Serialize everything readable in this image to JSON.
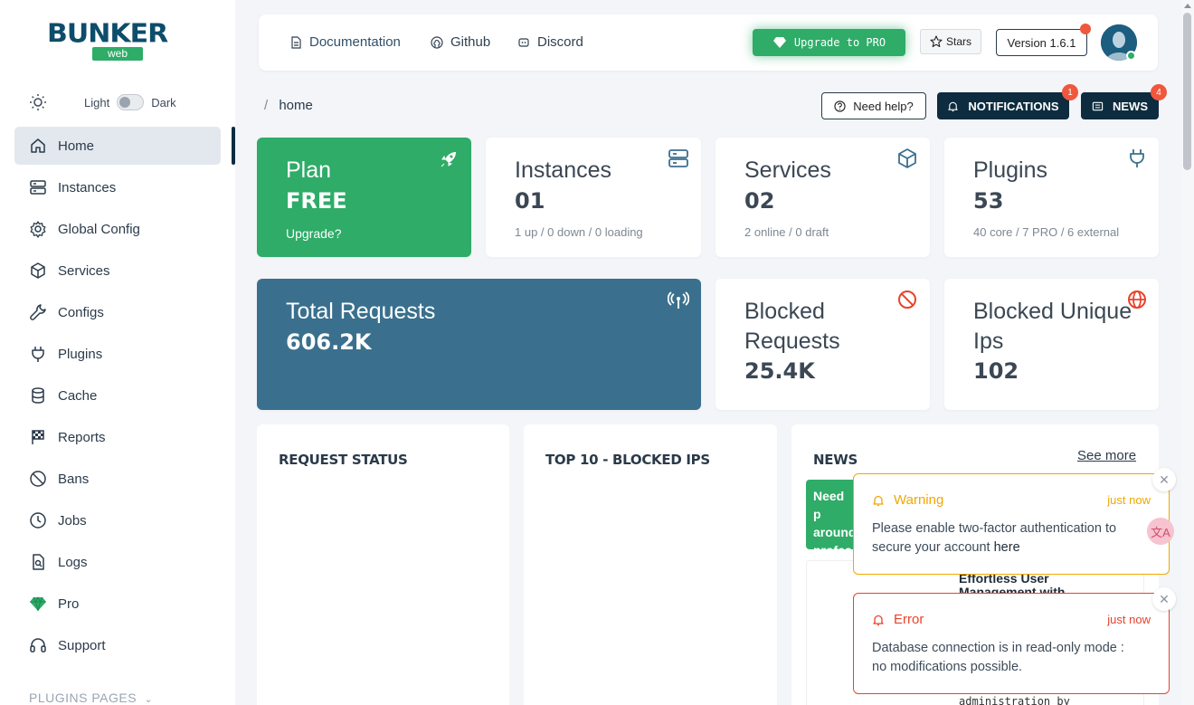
{
  "sidebar": {
    "logo_text": "BUNKER",
    "logo_sub": "web",
    "theme": {
      "light_label": "Light",
      "dark_label": "Dark"
    },
    "items": [
      {
        "label": "Home",
        "icon": "home-icon"
      },
      {
        "label": "Instances",
        "icon": "server-icon"
      },
      {
        "label": "Global Config",
        "icon": "gear-icon"
      },
      {
        "label": "Services",
        "icon": "cube-icon"
      },
      {
        "label": "Configs",
        "icon": "wrench-icon"
      },
      {
        "label": "Plugins",
        "icon": "plug-icon"
      },
      {
        "label": "Cache",
        "icon": "database-icon"
      },
      {
        "label": "Reports",
        "icon": "flag-icon"
      },
      {
        "label": "Bans",
        "icon": "ban-icon"
      },
      {
        "label": "Jobs",
        "icon": "clock-icon"
      },
      {
        "label": "Logs",
        "icon": "file-search-icon"
      },
      {
        "label": "Pro",
        "icon": "diamond-icon"
      },
      {
        "label": "Support",
        "icon": "headset-icon"
      }
    ],
    "plugins_pages_label": "PLUGINS PAGES"
  },
  "topbar": {
    "documentation": "Documentation",
    "github": "Github",
    "discord": "Discord",
    "upgrade": "Upgrade to PRO",
    "stars": "Stars",
    "version": "Version 1.6.1"
  },
  "breadcrumb": {
    "separator": "/",
    "current": "home"
  },
  "actions": {
    "help": "Need help?",
    "notifications": "NOTIFICATIONS",
    "notifications_count": "1",
    "news": "NEWS",
    "news_count": "4"
  },
  "cards": {
    "plan": {
      "title": "Plan",
      "value": "FREE",
      "sub": "Upgrade?"
    },
    "instances": {
      "title": "Instances",
      "value": "01",
      "sub": "1 up / 0 down / 0 loading"
    },
    "services": {
      "title": "Services",
      "value": "02",
      "sub": "2 online / 0 draft"
    },
    "plugins": {
      "title": "Plugins",
      "value": "53",
      "sub": "40 core / 7 PRO / 6 external"
    },
    "total_requests": {
      "title": "Total Requests",
      "value": "606.2K"
    },
    "blocked_requests": {
      "title": "Blocked Requests",
      "value": "25.4K"
    },
    "blocked_ips": {
      "title": "Blocked Unique Ips",
      "value": "102"
    }
  },
  "panels": {
    "request_status": "REQUEST STATUS",
    "top_blocked": "TOP 10 - BLOCKED IPS",
    "news": {
      "title": "NEWS",
      "see_more": "See more",
      "green_text": "Need p around profes",
      "card_text": "Effortless User Management with",
      "card_text2": "administration by"
    }
  },
  "toasts": {
    "warning": {
      "title": "Warning",
      "time": "just now",
      "body": "Please enable two-factor authentication to secure your account ",
      "link": "here",
      "color": "#f0a800"
    },
    "error": {
      "title": "Error",
      "time": "just now",
      "body": "Database connection is in read-only mode : no modifications possible.",
      "color": "#e8432b"
    },
    "close_glyph": "✕"
  },
  "colors": {
    "brand_dark": "#0d2c3f",
    "brand_green": "#2eac68",
    "brand_blue": "#3a708d",
    "badge_red": "#f0573c"
  }
}
